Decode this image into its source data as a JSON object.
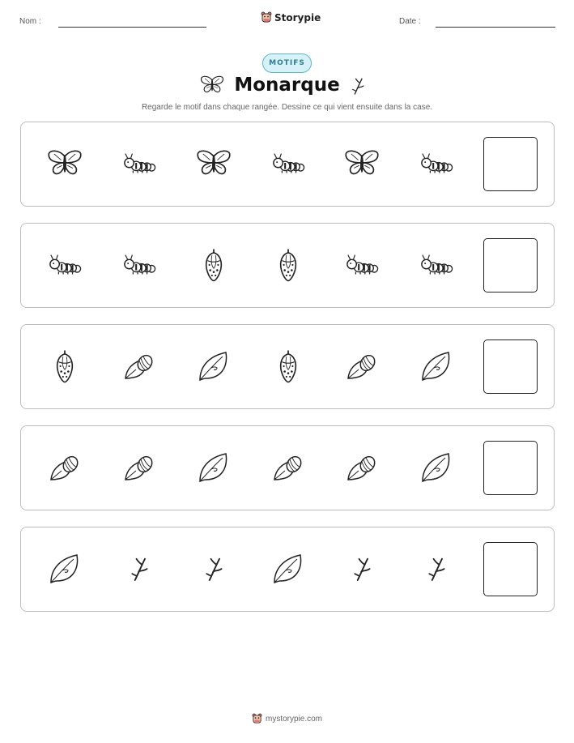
{
  "header": {
    "name_label": "Nom :",
    "date_label": "Date :",
    "brand": "Storypie"
  },
  "badge": "MOTIFS",
  "title": "Monarque",
  "title_icons": [
    "butterfly-icon",
    "twig-icon"
  ],
  "instructions": "Regarde le motif dans chaque rangée. Dessine ce qui vient ensuite dans la case.",
  "rows": [
    [
      "butterfly",
      "caterpillar",
      "butterfly",
      "caterpillar",
      "butterfly",
      "caterpillar"
    ],
    [
      "caterpillar",
      "caterpillar",
      "chrysalis",
      "chrysalis",
      "caterpillar",
      "caterpillar"
    ],
    [
      "chrysalis",
      "egg-on-leaf",
      "leaf",
      "chrysalis",
      "egg-on-leaf",
      "leaf"
    ],
    [
      "egg-on-leaf",
      "egg-on-leaf",
      "leaf",
      "egg-on-leaf",
      "egg-on-leaf",
      "leaf"
    ],
    [
      "leaf",
      "twig",
      "twig",
      "leaf",
      "twig",
      "twig"
    ]
  ],
  "footer": {
    "site": "mystorypie.com"
  },
  "colors": {
    "badge_bg": "#d8f1f7",
    "badge_border": "#58b9cf",
    "badge_text": "#2a7f93",
    "logo_accent": "#e8747c"
  }
}
